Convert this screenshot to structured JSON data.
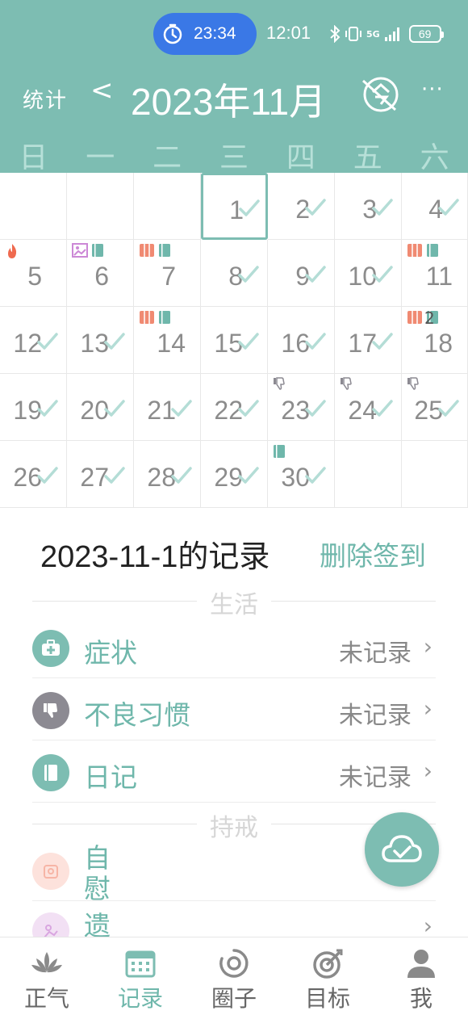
{
  "status_bar": {
    "timer": "23:34",
    "clock": "12:01",
    "network": "5G",
    "battery": "69"
  },
  "header": {
    "stats_label": "统计",
    "prev_label": "<",
    "month_title": "2023年11月",
    "more_label": "···"
  },
  "weekdays": [
    "日",
    "一",
    "二",
    "三",
    "四",
    "五",
    "六"
  ],
  "calendar": {
    "days": [
      {
        "day": "1",
        "col": 3,
        "row": 0,
        "checked": true,
        "selected": true,
        "badges": []
      },
      {
        "day": "2",
        "col": 4,
        "row": 0,
        "checked": true,
        "badges": []
      },
      {
        "day": "3",
        "col": 5,
        "row": 0,
        "checked": true,
        "badges": []
      },
      {
        "day": "4",
        "col": 6,
        "row": 0,
        "checked": true,
        "badges": []
      },
      {
        "day": "5",
        "col": 0,
        "row": 1,
        "checked": false,
        "badges": [
          "fire"
        ]
      },
      {
        "day": "6",
        "col": 1,
        "row": 1,
        "checked": false,
        "badges": [
          "spill",
          "diary"
        ]
      },
      {
        "day": "7",
        "col": 2,
        "row": 1,
        "checked": false,
        "badges": [
          "roll",
          "diary"
        ]
      },
      {
        "day": "8",
        "col": 3,
        "row": 1,
        "checked": true,
        "badges": []
      },
      {
        "day": "9",
        "col": 4,
        "row": 1,
        "checked": true,
        "badges": []
      },
      {
        "day": "10",
        "col": 5,
        "row": 1,
        "checked": true,
        "badges": []
      },
      {
        "day": "11",
        "col": 6,
        "row": 1,
        "checked": false,
        "badges": [
          "roll",
          "diary"
        ]
      },
      {
        "day": "12",
        "col": 0,
        "row": 2,
        "checked": true,
        "badges": []
      },
      {
        "day": "13",
        "col": 1,
        "row": 2,
        "checked": true,
        "badges": []
      },
      {
        "day": "14",
        "col": 2,
        "row": 2,
        "checked": false,
        "badges": [
          "roll",
          "diary"
        ]
      },
      {
        "day": "15",
        "col": 3,
        "row": 2,
        "checked": true,
        "badges": []
      },
      {
        "day": "16",
        "col": 4,
        "row": 2,
        "checked": true,
        "badges": []
      },
      {
        "day": "17",
        "col": 5,
        "row": 2,
        "checked": true,
        "badges": []
      },
      {
        "day": "18",
        "col": 6,
        "row": 2,
        "checked": false,
        "badges": [
          "roll",
          "diary"
        ],
        "badge_count": "2"
      },
      {
        "day": "19",
        "col": 0,
        "row": 3,
        "checked": true,
        "badges": []
      },
      {
        "day": "20",
        "col": 1,
        "row": 3,
        "checked": true,
        "badges": []
      },
      {
        "day": "21",
        "col": 2,
        "row": 3,
        "checked": true,
        "badges": []
      },
      {
        "day": "22",
        "col": 3,
        "row": 3,
        "checked": true,
        "badges": []
      },
      {
        "day": "23",
        "col": 4,
        "row": 3,
        "checked": true,
        "badges": [
          "thumb"
        ]
      },
      {
        "day": "24",
        "col": 5,
        "row": 3,
        "checked": true,
        "badges": [
          "thumb"
        ]
      },
      {
        "day": "25",
        "col": 6,
        "row": 3,
        "checked": true,
        "badges": [
          "thumb"
        ]
      },
      {
        "day": "26",
        "col": 0,
        "row": 4,
        "checked": true,
        "badges": []
      },
      {
        "day": "27",
        "col": 1,
        "row": 4,
        "checked": true,
        "badges": []
      },
      {
        "day": "28",
        "col": 2,
        "row": 4,
        "checked": true,
        "badges": []
      },
      {
        "day": "29",
        "col": 3,
        "row": 4,
        "checked": true,
        "badges": []
      },
      {
        "day": "30",
        "col": 4,
        "row": 4,
        "checked": true,
        "badges": [
          "diary"
        ]
      }
    ]
  },
  "records": {
    "title": "2023-11-1的记录",
    "delete_label": "删除签到",
    "section_life": "生活",
    "section_precepts": "持戒",
    "rows": [
      {
        "label": "症状",
        "value": "未记录",
        "icon": "medkit-icon"
      },
      {
        "label": "不良习惯",
        "value": "未记录",
        "icon": "thumbs-down-icon"
      },
      {
        "label": "日记",
        "value": "未记录",
        "icon": "diary-icon"
      }
    ],
    "precept_rows": [
      {
        "label": "自慰",
        "icon": "roll-icon"
      },
      {
        "label": "遗",
        "icon": "spill-icon"
      }
    ]
  },
  "bottom_nav": {
    "tabs": [
      {
        "label": "正气",
        "icon": "lotus-icon"
      },
      {
        "label": "记录",
        "icon": "calendar-icon",
        "active": true
      },
      {
        "label": "圈子",
        "icon": "circle-icon"
      },
      {
        "label": "目标",
        "icon": "target-icon"
      },
      {
        "label": "我",
        "icon": "user-icon"
      }
    ]
  },
  "colors": {
    "accent": "#7dbdb2",
    "accent_text": "#6fb7ab",
    "timer_pill": "#3a78e6",
    "roll_badge": "#f08a72",
    "thumb_icon": "#8c8a92"
  }
}
